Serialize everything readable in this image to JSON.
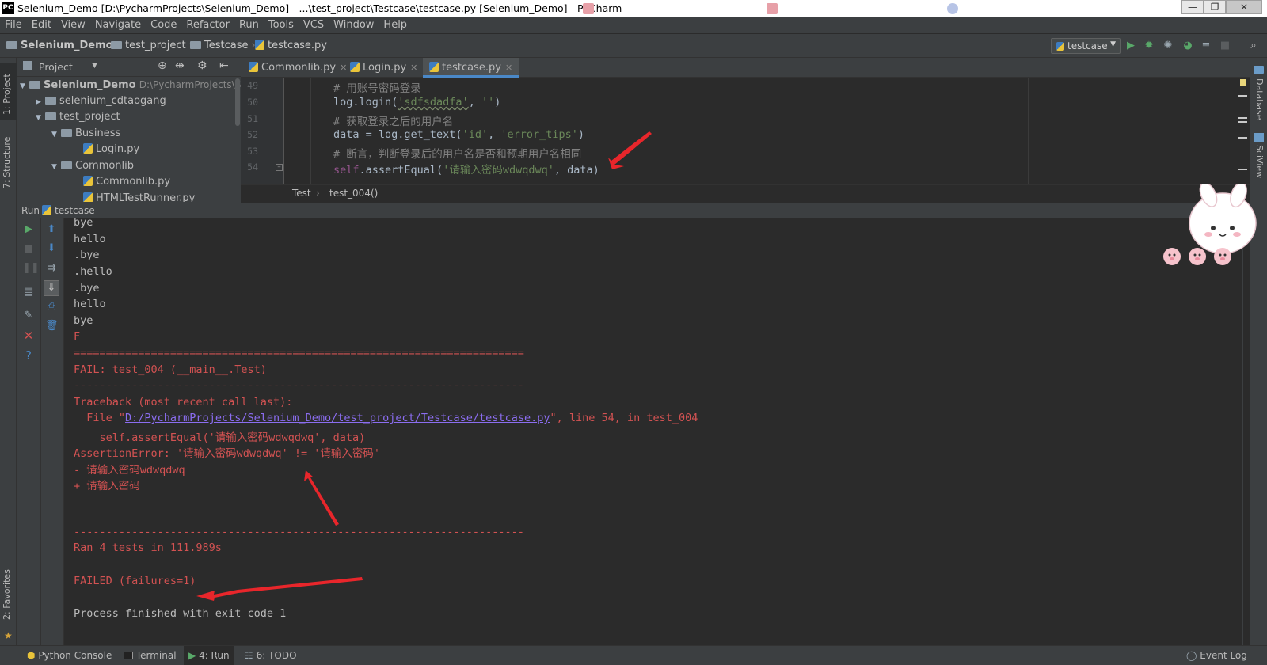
{
  "window": {
    "title": "Selenium_Demo [D:\\PycharmProjects\\Selenium_Demo] - ...\\test_project\\Testcase\\testcase.py [Selenium_Demo] - PyCharm",
    "logo_text": "PC"
  },
  "menu": [
    "File",
    "Edit",
    "View",
    "Navigate",
    "Code",
    "Refactor",
    "Run",
    "Tools",
    "VCS",
    "Window",
    "Help"
  ],
  "navbar": {
    "crumbs": [
      "Selenium_Demo",
      "test_project",
      "Testcase",
      "testcase.py"
    ],
    "run_config": "testcase"
  },
  "left_stripe": {
    "project_tab": "1: Project",
    "structure_tab": "7: Structure",
    "favorites_tab": "2: Favorites"
  },
  "right_stripe": {
    "database_tab": "Database",
    "sciview_tab": "SciView"
  },
  "project": {
    "header": "Project",
    "tree": [
      {
        "label": "Selenium_Demo",
        "hint": "D:\\PycharmProjects\\Sel",
        "expanded": true
      },
      {
        "label": "selenium_cdtaogang",
        "expanded": false
      },
      {
        "label": "test_project",
        "expanded": true
      },
      {
        "label": "Business",
        "expanded": true
      },
      {
        "label": "Login.py"
      },
      {
        "label": "Commonlib",
        "expanded": true
      },
      {
        "label": "Commonlib.py"
      },
      {
        "label": "HTMLTestRunner.py"
      }
    ]
  },
  "editor": {
    "tabs": [
      {
        "label": "Commonlib.py",
        "active": false
      },
      {
        "label": "Login.py",
        "active": false
      },
      {
        "label": "testcase.py",
        "active": true
      }
    ],
    "line_numbers": [
      "49",
      "50",
      "51",
      "52",
      "53",
      "54"
    ],
    "lines": {
      "l49": "# 用账号密码登录",
      "l50_a": "log.login(",
      "l50_b": "'sdfsdadfa'",
      "l50_c": ", ",
      "l50_d": "''",
      "l50_e": ")",
      "l51": "# 获取登录之后的用户名",
      "l52_a": "data = log.get_text(",
      "l52_b": "'id'",
      "l52_c": ", ",
      "l52_d": "'error_tips'",
      "l52_e": ")",
      "l53": "# 断言，判断登录后的用户名是否和预期用户名相同",
      "l54_a": "self",
      "l54_b": ".assertEqual(",
      "l54_c": "'请输入密码wdwqdwq'",
      "l54_d": ", data)"
    },
    "breadcrumb": [
      "Test",
      "test_004()"
    ]
  },
  "run": {
    "header_label": "Run",
    "config": "testcase",
    "console": {
      "c1": "bye",
      "c2": "hello",
      "c3": ".bye",
      "c4": ".hello",
      "c5": ".bye",
      "c6": "hello",
      "c7": "bye",
      "c8": "F",
      "c9": "======================================================================",
      "c10": "FAIL: test_004 (__main__.Test)",
      "c11": "----------------------------------------------------------------------",
      "c12": "Traceback (most recent call last):",
      "c13_a": "  File \"",
      "c13_link": "D:/PycharmProjects/Selenium_Demo/test_project/Testcase/testcase.py",
      "c13_b": "\", line 54, in test_004",
      "c14": "    self.assertEqual('请输入密码wdwqdwq', data)",
      "c15": "AssertionError: '请输入密码wdwqdwq' != '请输入密码'",
      "c16": "- 请输入密码wdwqdwq",
      "c17": "+ 请输入密码",
      "c18": "----------------------------------------------------------------------",
      "c19": "Ran 4 tests in 111.989s",
      "c20": "FAILED (failures=1)",
      "c21": "Process finished with exit code 1"
    }
  },
  "bottom": {
    "python_console": "Python Console",
    "terminal": "Terminal",
    "run": "4: Run",
    "todo": "6: TODO",
    "event_log": "Event Log"
  },
  "colors": {
    "accent": "#4a88c7",
    "error": "#d25252",
    "run_green": "#59a869",
    "arrow_red": "#e8262b"
  }
}
